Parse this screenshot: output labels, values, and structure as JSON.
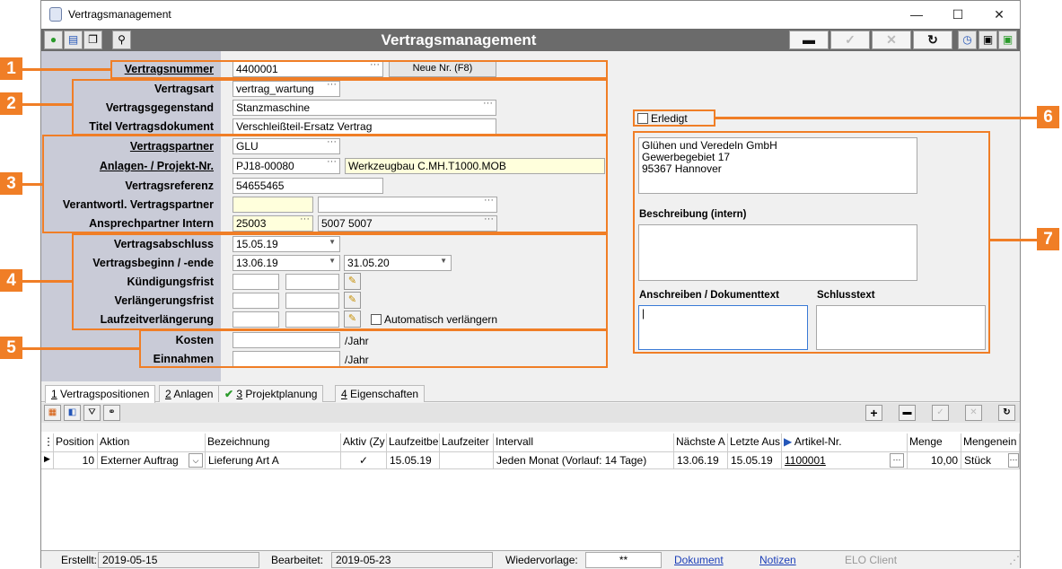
{
  "window": {
    "title": "Vertragsmanagement",
    "minimize": "—",
    "maximize": "☐",
    "close": "✕"
  },
  "header": {
    "title": "Vertragsmanagement"
  },
  "toolbar_right": {
    "remove": "▬",
    "confirm": "✓",
    "cancel": "✕",
    "refresh": "↻"
  },
  "callouts": [
    "1",
    "2",
    "3",
    "4",
    "5",
    "6",
    "7"
  ],
  "section1": {
    "vertragsnummer_label": "Vertragsnummer",
    "vertragsnummer": "4400001",
    "neue_nr_button": "Neue Nr. (F8)"
  },
  "section2": {
    "vertragsart_label": "Vertragsart",
    "vertragsart": "vertrag_wartung",
    "gegenstand_label": "Vertragsgegenstand",
    "gegenstand": "Stanzmaschine",
    "titel_label": "Titel Vertragsdokument",
    "titel": "Verschleißteil-Ersatz Vertrag"
  },
  "section3": {
    "partner_label": "Vertragspartner",
    "partner": "GLU",
    "anlagen_label": "Anlagen- / Projekt-Nr.",
    "anlagen": "PJ18-00080",
    "anlagen_desc": "Werkzeugbau C.MH.T1000.MOB",
    "referenz_label": "Vertragsreferenz",
    "referenz": "54655465",
    "verantwortl_label": "Verantwortl. Vertragspartner",
    "verantwortl": "",
    "verantwortl_desc": "",
    "intern_label": "Ansprechpartner Intern",
    "intern": "25003",
    "intern_desc": "5007 5007"
  },
  "section4": {
    "abschluss_label": "Vertragsabschluss",
    "abschluss": "15.05.19",
    "beginn_label": "Vertragsbeginn / -ende",
    "beginn": "13.06.19",
    "ende": "31.05.20",
    "kuendigung_label": "Kündigungsfrist",
    "verlaengerung_label": "Verlängerungsfrist",
    "laufzeit_label": "Laufzeitverlängerung",
    "auto_label": "Automatisch verlängern"
  },
  "section5": {
    "kosten_label": "Kosten",
    "kosten_unit": "/Jahr",
    "einnahmen_label": "Einnahmen",
    "einnahmen_unit": "/Jahr"
  },
  "section6": {
    "erledigt_label": "Erledigt"
  },
  "section7": {
    "address": [
      "Glühen und Veredeln GmbH",
      "Gewerbegebiet 17",
      "95367 Hannover"
    ],
    "beschreibung_label": "Beschreibung (intern)",
    "anschreiben_label": "Anschreiben / Dokumenttext",
    "schlusstext_label": "Schlusstext"
  },
  "tabs": [
    {
      "num": "1",
      "label": " Vertragspositionen"
    },
    {
      "num": "2",
      "label": " Anlagen"
    },
    {
      "num": "3",
      "label": " Projektplanung"
    },
    {
      "num": "4",
      "label": " Eigenschaften"
    }
  ],
  "grid_toolbar": {
    "add": "+",
    "remove": "▬",
    "confirm": "✓",
    "cancel": "✕",
    "refresh": "↻"
  },
  "grid": {
    "columns": [
      "Position",
      "Aktion",
      "Bezeichnung",
      "Aktiv (Zy",
      "Laufzeitbe",
      "Laufzeiter",
      "Intervall",
      "Nächste A",
      "Letzte Aus",
      "Artikel-Nr.",
      "Menge",
      "Mengenein"
    ],
    "row": {
      "position": "10",
      "aktion": "Externer Auftrag",
      "bezeichnung": "Lieferung Art A",
      "aktiv": "✓",
      "laufzeitbeginn": "15.05.19",
      "laufzeitende": "",
      "intervall": "Jeden Monat (Vorlauf: 14 Tage)",
      "naechste": "13.06.19",
      "letzte": "15.05.19",
      "artikel": "1100001",
      "menge": "10,00",
      "einheit": "Stück"
    }
  },
  "status": {
    "erstellt_label": "Erstellt:",
    "erstellt": "2019-05-15",
    "bearbeitet_label": "Bearbeitet:",
    "bearbeitet": "2019-05-23",
    "wiedervorlage_label": "Wiedervorlage:",
    "wiedervorlage": "**",
    "dokument": "Dokument",
    "notizen": "Notizen",
    "elo": "ELO Client"
  },
  "colors": {
    "accent": "#f07e26",
    "toolbar": "#6b6b6b",
    "label_panel": "#c9cbd7"
  }
}
